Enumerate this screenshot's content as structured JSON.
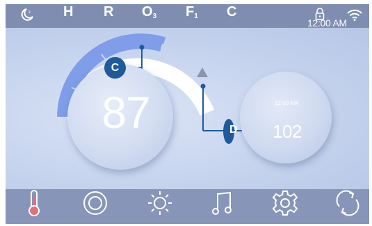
{
  "status_bar": {
    "items": [
      {
        "label": "H",
        "sub": ""
      },
      {
        "label": "R",
        "sub": ""
      },
      {
        "label": "O",
        "sub": "3"
      },
      {
        "label": "F",
        "sub": "1"
      },
      {
        "label": "C",
        "sub": ""
      }
    ],
    "icons": [
      "moon-icon",
      "lock-icon",
      "wifi-icon"
    ]
  },
  "clock": "12:00 AM",
  "main_dial": {
    "temperature": "87",
    "marker_label": "C"
  },
  "secondary_dial": {
    "time": "12:00 AM",
    "temperature": "102",
    "marker_label": "D"
  },
  "nav": [
    "thermometer-icon",
    "target-icon",
    "sun-icon",
    "music-icon",
    "gear-icon",
    "refresh-icon"
  ],
  "colors": {
    "top_bar": "#7f8db0",
    "bottom_bar": "#8795b8",
    "arc_active": "#7f9de8",
    "marker": "#1f5a9a"
  }
}
